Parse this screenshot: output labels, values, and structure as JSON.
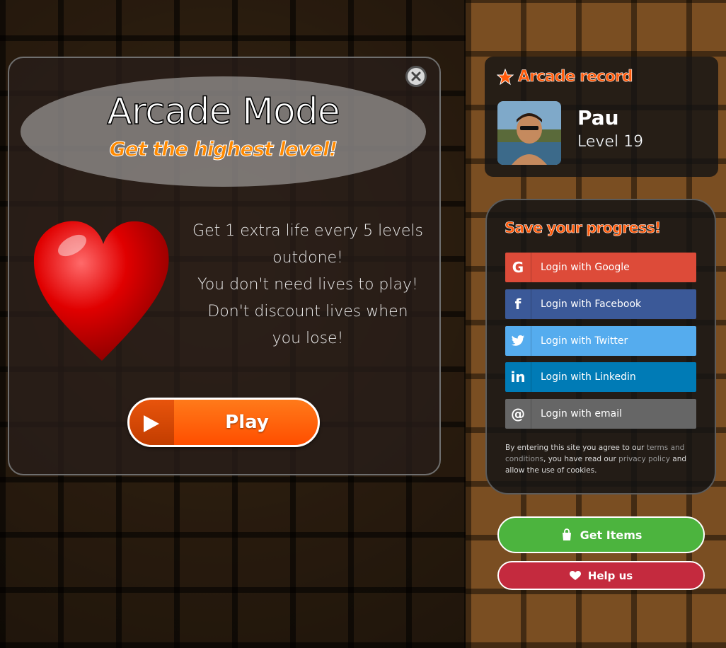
{
  "modal": {
    "title": "Arcade Mode",
    "subtitle": "Get the highest level!",
    "info_lines": [
      "Get 1 extra life every 5 levels outdone!",
      "You don't need lives to play!",
      "Don't discount lives when you lose!"
    ],
    "play_label": "Play",
    "close_icon": "close-icon",
    "heart_icon": "heart-icon"
  },
  "record": {
    "title": "Arcade record",
    "title_icon": "star-icon",
    "player_name": "Pau",
    "player_level": "Level 19"
  },
  "save": {
    "title": "Save your progress!",
    "buttons": [
      {
        "label": "Login with Google",
        "icon": "google-icon",
        "glyph": "G",
        "color": "#dd4b39"
      },
      {
        "label": "Login with Facebook",
        "icon": "facebook-icon",
        "glyph": "f",
        "color": "#3b5998"
      },
      {
        "label": "Login with Twitter",
        "icon": "twitter-icon",
        "glyph": "t",
        "color": "#55acee"
      },
      {
        "label": "Login with Linkedin",
        "icon": "linkedin-icon",
        "glyph": "in",
        "color": "#007bb6"
      },
      {
        "label": "Login with email",
        "icon": "email-icon",
        "glyph": "@",
        "color": "#666666"
      }
    ],
    "legal_prefix": "By entering this site you agree to our ",
    "legal_terms": "terms and conditions",
    "legal_middle": ", you have read our ",
    "legal_privacy": "privacy policy",
    "legal_suffix": " and allow the use of cookies."
  },
  "actions": {
    "get_items": "Get Items",
    "help_us": "Help us"
  },
  "colors": {
    "accent_orange": "#ff5a0a",
    "get_items_green": "#4cb43e",
    "help_red": "#c42a3e"
  }
}
